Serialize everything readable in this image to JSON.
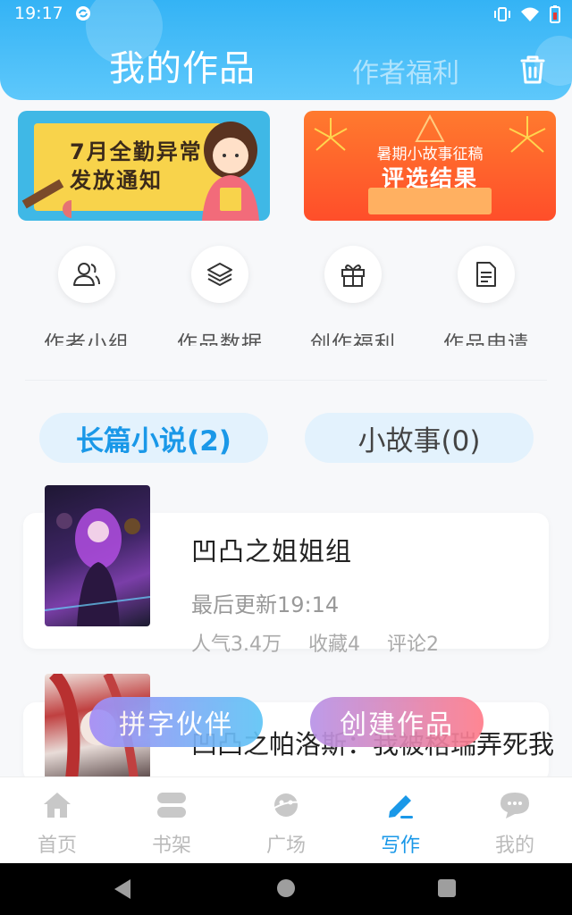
{
  "status": {
    "time": "19:17"
  },
  "header": {
    "title": "我的作品",
    "subtitle_tab": "作者福利"
  },
  "banners": {
    "left": {
      "line1": "7月全勤异常",
      "line2": "发放通知"
    },
    "right": {
      "line1": "暑期小故事征稿",
      "line2": "评选结果"
    }
  },
  "quick_links": [
    {
      "label": "作者小组",
      "icon": "people-icon"
    },
    {
      "label": "作品数据",
      "icon": "layers-icon"
    },
    {
      "label": "创作福利",
      "icon": "gift-icon"
    },
    {
      "label": "作品申请",
      "icon": "document-icon"
    }
  ],
  "tabs": {
    "long_novel": "长篇小说(2)",
    "short_story": "小故事(0)"
  },
  "works": [
    {
      "title": "凹凸之姐姐组",
      "updated": "最后更新19:14",
      "popularity": "人气3.4万",
      "favorites": "收藏4",
      "comments": "评论2"
    },
    {
      "title": "凹凸之帕洛斯：我被格瑞弄死我"
    }
  ],
  "floating": {
    "partner": "拼字伙伴",
    "create": "创建作品"
  },
  "bottom_nav": [
    {
      "label": "首页",
      "icon": "home-icon"
    },
    {
      "label": "书架",
      "icon": "bookshelf-icon"
    },
    {
      "label": "广场",
      "icon": "planet-icon"
    },
    {
      "label": "写作",
      "icon": "pen-icon",
      "active": true
    },
    {
      "label": "我的",
      "icon": "chat-icon"
    }
  ],
  "colors": {
    "accent": "#1a98e8",
    "header": "#34b3f5"
  }
}
